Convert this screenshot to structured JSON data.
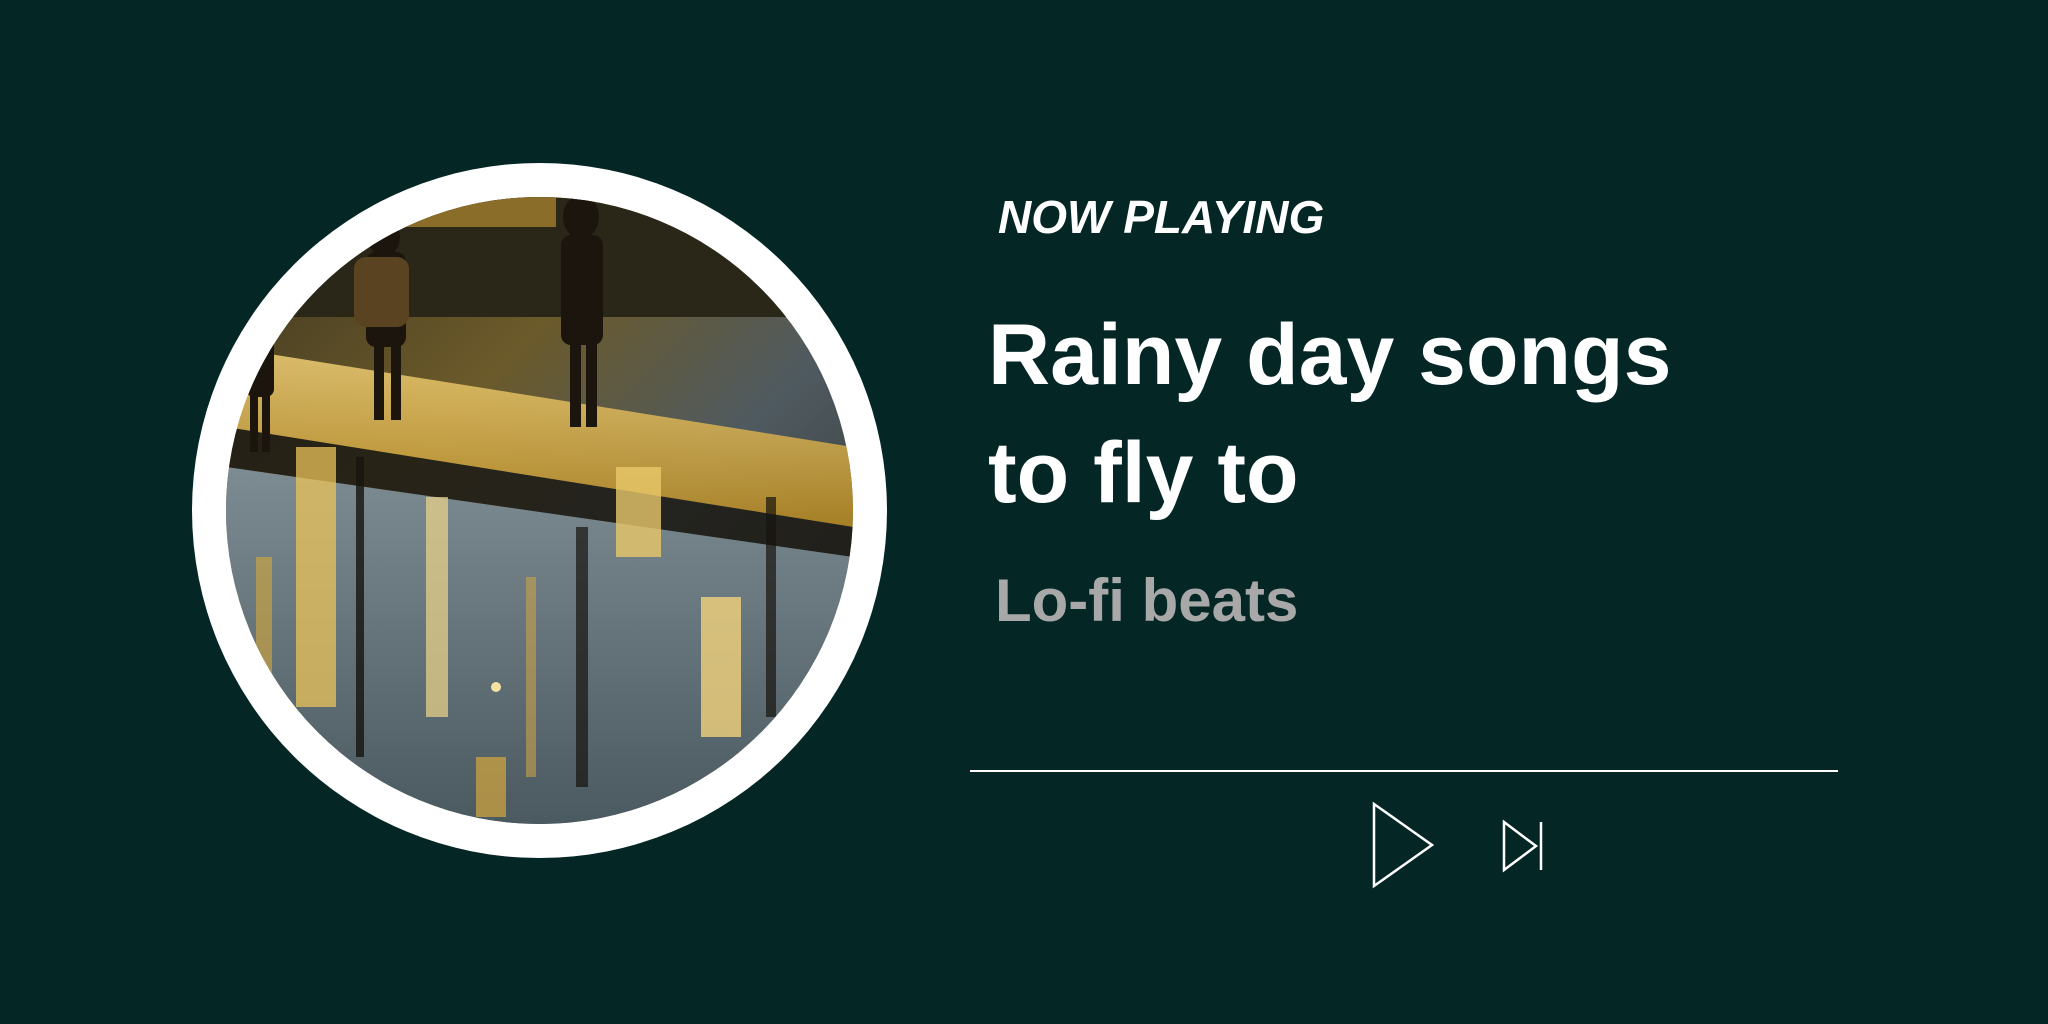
{
  "player": {
    "kicker": "NOW PLAYING",
    "title_lines": [
      "Rainy day songs",
      "to fly to"
    ],
    "artist": "Lo-fi beats",
    "progress": 0
  },
  "album_art": {
    "description_icon": "album-art-image"
  },
  "controls": {
    "play_icon": "play-icon",
    "next_icon": "skip-next-icon"
  },
  "colors": {
    "background": "#042625",
    "text_primary": "#ffffff",
    "text_secondary": "#a8a8a8",
    "ring": "#ffffff"
  }
}
